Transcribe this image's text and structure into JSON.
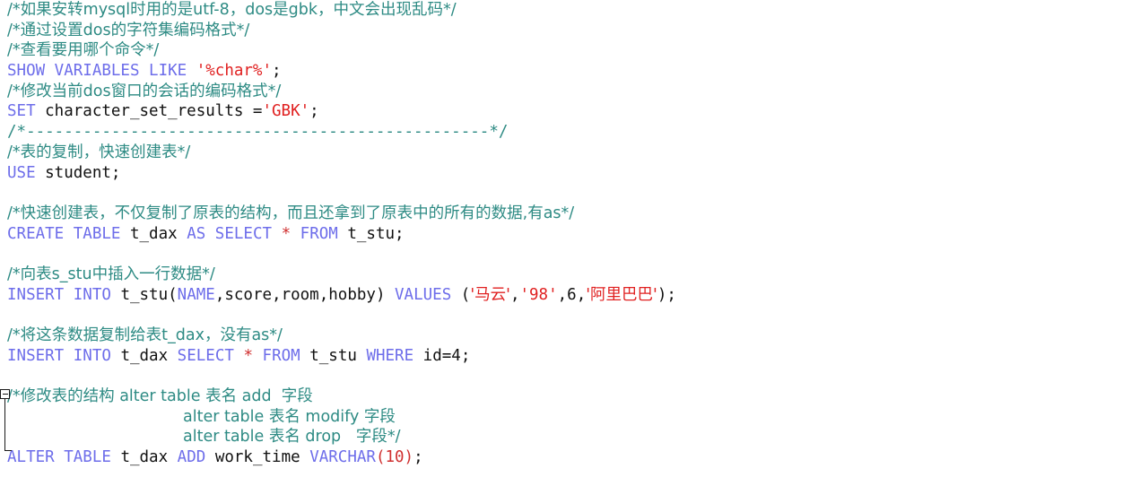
{
  "editor": {
    "title": "sql-script-editor",
    "background_color": "#ffffff",
    "colors": {
      "comment": "#2e8b84",
      "keyword": "#6d6dea",
      "string": "#e02020",
      "plain": "#111111",
      "punctuation": "#d03030"
    },
    "gutter": {
      "fold_marker": "collapse-minus-icon",
      "fold_state": "expanded"
    }
  },
  "code": {
    "lines": [
      {
        "n": 1,
        "indent": 0,
        "tokens": [
          {
            "t": "cmt",
            "v": "/*如果安转mysql时用的是utf-8，dos是gbk，中文会出现乱码*/"
          }
        ]
      },
      {
        "n": 2,
        "indent": 0,
        "tokens": [
          {
            "t": "cmt",
            "v": "/*通过设置dos的字符集编码格式*/"
          }
        ]
      },
      {
        "n": 3,
        "indent": 0,
        "tokens": [
          {
            "t": "cmt",
            "v": "/*查看要用哪个命令*/"
          }
        ]
      },
      {
        "n": 4,
        "indent": 0,
        "tokens": [
          {
            "t": "kw",
            "v": "SHOW VARIABLES LIKE "
          },
          {
            "t": "str",
            "v": "'%char%'"
          },
          {
            "t": "plain",
            "v": ";"
          }
        ]
      },
      {
        "n": 5,
        "indent": 0,
        "tokens": [
          {
            "t": "cmt",
            "v": "/*修改当前dos窗口的会话的编码格式*/"
          }
        ]
      },
      {
        "n": 6,
        "indent": 0,
        "tokens": [
          {
            "t": "kw",
            "v": "SET"
          },
          {
            "t": "plain",
            "v": " character_set_results ="
          },
          {
            "t": "str",
            "v": "'GBK'"
          },
          {
            "t": "plain",
            "v": ";"
          }
        ]
      },
      {
        "n": 7,
        "indent": 0,
        "tokens": [
          {
            "t": "cmt",
            "v": "/*-------------------------------------------------*/"
          }
        ]
      },
      {
        "n": 8,
        "indent": 0,
        "tokens": [
          {
            "t": "cmt",
            "v": "/*表的复制，快速创建表*/"
          }
        ]
      },
      {
        "n": 9,
        "indent": 0,
        "tokens": [
          {
            "t": "kw",
            "v": "USE"
          },
          {
            "t": "plain",
            "v": " student;"
          }
        ]
      },
      {
        "n": 10,
        "indent": 0,
        "tokens": []
      },
      {
        "n": 11,
        "indent": 0,
        "tokens": [
          {
            "t": "cmt",
            "v": "/*快速创建表，不仅复制了原表的结构，而且还拿到了原表中的所有的数据,有as*/"
          }
        ]
      },
      {
        "n": 12,
        "indent": 0,
        "tokens": [
          {
            "t": "kw",
            "v": "CREATE TABLE"
          },
          {
            "t": "plain",
            "v": " t_dax "
          },
          {
            "t": "kw",
            "v": "AS SELECT"
          },
          {
            "t": "plain",
            "v": " "
          },
          {
            "t": "punct",
            "v": "*"
          },
          {
            "t": "plain",
            "v": " "
          },
          {
            "t": "kw",
            "v": "FROM"
          },
          {
            "t": "plain",
            "v": " t_stu;"
          }
        ]
      },
      {
        "n": 13,
        "indent": 0,
        "tokens": []
      },
      {
        "n": 14,
        "indent": 0,
        "tokens": [
          {
            "t": "cmt",
            "v": "/*向表s_stu中插入一行数据*/"
          }
        ]
      },
      {
        "n": 15,
        "indent": 0,
        "tokens": [
          {
            "t": "kw",
            "v": "INSERT INTO"
          },
          {
            "t": "plain",
            "v": " t_stu("
          },
          {
            "t": "kw",
            "v": "NAME"
          },
          {
            "t": "plain",
            "v": ",score,room,hobby) "
          },
          {
            "t": "kw",
            "v": "VALUES"
          },
          {
            "t": "plain",
            "v": " ("
          },
          {
            "t": "str",
            "v": "'马云'"
          },
          {
            "t": "plain",
            "v": ","
          },
          {
            "t": "str",
            "v": "'98'"
          },
          {
            "t": "plain",
            "v": ",6,"
          },
          {
            "t": "str",
            "v": "'阿里巴巴'"
          },
          {
            "t": "plain",
            "v": ");"
          }
        ]
      },
      {
        "n": 16,
        "indent": 0,
        "tokens": []
      },
      {
        "n": 17,
        "indent": 0,
        "tokens": [
          {
            "t": "cmt",
            "v": "/*将这条数据复制给表t_dax，没有as*/"
          }
        ]
      },
      {
        "n": 18,
        "indent": 0,
        "tokens": [
          {
            "t": "kw",
            "v": "INSERT INTO"
          },
          {
            "t": "plain",
            "v": " t_dax "
          },
          {
            "t": "kw",
            "v": "SELECT"
          },
          {
            "t": "plain",
            "v": " "
          },
          {
            "t": "punct",
            "v": "*"
          },
          {
            "t": "plain",
            "v": " "
          },
          {
            "t": "kw",
            "v": "FROM"
          },
          {
            "t": "plain",
            "v": " t_stu "
          },
          {
            "t": "kw",
            "v": "WHERE"
          },
          {
            "t": "plain",
            "v": " id=4;"
          }
        ]
      },
      {
        "n": 19,
        "indent": 0,
        "tokens": []
      },
      {
        "n": 20,
        "indent": 0,
        "tokens": [
          {
            "t": "cmt",
            "v": "/*修改表的结构 alter table 表名 add  字段"
          }
        ]
      },
      {
        "n": 21,
        "indent": 196,
        "tokens": [
          {
            "t": "cmt",
            "v": "alter table 表名 modify 字段"
          }
        ]
      },
      {
        "n": 22,
        "indent": 196,
        "tokens": [
          {
            "t": "cmt",
            "v": "alter table 表名 drop   字段*/"
          }
        ]
      },
      {
        "n": 23,
        "indent": 0,
        "tokens": [
          {
            "t": "kw",
            "v": "ALTER TABLE"
          },
          {
            "t": "plain",
            "v": " t_dax "
          },
          {
            "t": "kw",
            "v": "ADD"
          },
          {
            "t": "plain",
            "v": " work_time "
          },
          {
            "t": "kw",
            "v": "VARCHAR"
          },
          {
            "t": "punct",
            "v": "(10)"
          },
          {
            "t": "plain",
            "v": ";"
          }
        ]
      }
    ]
  }
}
